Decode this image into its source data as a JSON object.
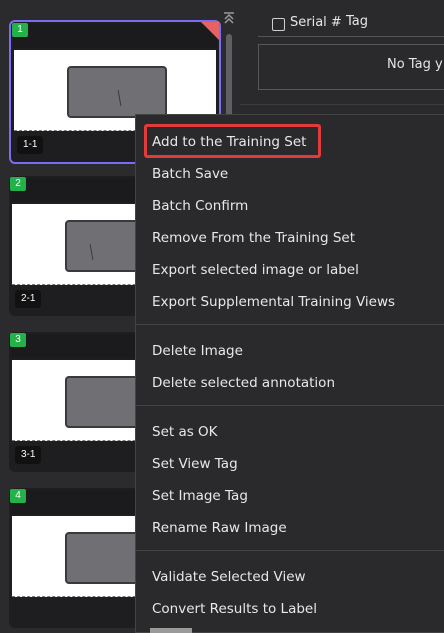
{
  "thumbnails": [
    {
      "number": "1",
      "label": "1-1"
    },
    {
      "number": "2",
      "label": "2-1"
    },
    {
      "number": "3",
      "label": "3-1"
    },
    {
      "number": "4",
      "label": ""
    }
  ],
  "scrollbar": {
    "top_icon": "chevron-double-up-icon"
  },
  "tag_table": {
    "serial_header": "Serial #",
    "tag_header": "Tag",
    "empty_text": "No Tag y"
  },
  "context_menu": {
    "items": [
      "Add to the Training Set",
      "Batch Save",
      "Batch Confirm",
      "Remove From the Training Set",
      "Export selected image or label",
      "Export Supplemental Training Views",
      "Delete Image",
      "Delete selected annotation",
      "Set as OK",
      "Set View Tag",
      "Set Image Tag",
      "Rename Raw Image",
      "Validate Selected View",
      "Convert Results to Label"
    ],
    "highlighted_item": "Add to the Training Set"
  },
  "colors": {
    "selection_border": "#7b6cf6",
    "badge_green": "#23b24a",
    "highlight_red": "#e23b3b",
    "corner_flag": "#e66363"
  }
}
